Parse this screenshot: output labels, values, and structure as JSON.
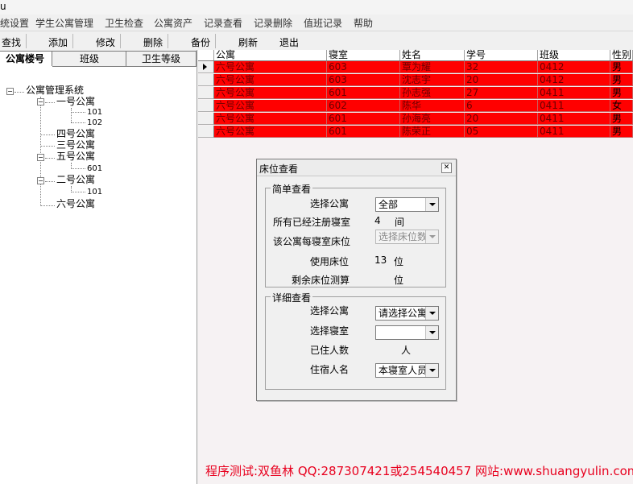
{
  "window": {
    "title_fragment": "u"
  },
  "menu": [
    "统设置",
    "学生公寓管理",
    "卫生检查",
    "公寓资产",
    "记录查看",
    "记录删除",
    "值班记录",
    "帮助"
  ],
  "toolbar": {
    "find": "查找",
    "add": "添加",
    "edit": "修改",
    "delete": "删除",
    "backup": "备份",
    "refresh": "刷新",
    "exit": "退出"
  },
  "tabs": [
    "公寓楼号",
    "班级",
    "卫生等级"
  ],
  "tree": {
    "root": "公寓管理系统",
    "b1": "一号公寓",
    "b1_r1": "101",
    "b1_r2": "102",
    "b4": "四号公寓",
    "b3": "三号公寓",
    "b5": "五号公寓",
    "b5_r1": "601",
    "b2": "二号公寓",
    "b2_r1": "101",
    "b6": "六号公寓"
  },
  "grid": {
    "columns": [
      "公寓",
      "寝室",
      "姓名",
      "学号",
      "班级",
      "性别"
    ],
    "rows": [
      [
        "六号公寓",
        "603",
        "覃为耀",
        "32",
        "0412",
        "男"
      ],
      [
        "六号公寓",
        "603",
        "沈志宇",
        "20",
        "0412",
        "男"
      ],
      [
        "六号公寓",
        "601",
        "孙志强",
        "27",
        "0411",
        "男"
      ],
      [
        "六号公寓",
        "602",
        "陈华",
        "6",
        "0411",
        "女"
      ],
      [
        "六号公寓",
        "601",
        "孙海亮",
        "20",
        "0411",
        "男"
      ],
      [
        "六号公寓",
        "601",
        "陈荣正",
        "05",
        "0411",
        "男"
      ]
    ]
  },
  "dialog": {
    "title": "床位查看",
    "simple": {
      "title": "简单查看",
      "select_building_label": "选择公寓",
      "select_building_value": "全部",
      "registered_label": "所有已经注册寝室",
      "registered_value": "4",
      "registered_unit": "间",
      "beds_per_room_label": "该公寓每寝室床位",
      "beds_per_room_value": "选择床位数",
      "used_label": "使用床位",
      "used_value": "13",
      "used_unit": "位",
      "remaining_label": "剩余床位测算",
      "remaining_unit": "位"
    },
    "detail": {
      "title": "详细查看",
      "select_building_label": "选择公寓",
      "select_building_value": "请选择公寓",
      "select_room_label": "选择寝室",
      "select_room_value": "",
      "occupied_label": "已住人数",
      "occupied_unit": "人",
      "residents_label": "住宿人名",
      "residents_value": "本寝室人员"
    }
  },
  "footer": "程序测试:双鱼林 QQ:287307421或254540457 网站:www.shuangyulin.com",
  "colors": {
    "row_highlight": "#ff0000",
    "footer_text": "#e8001e"
  }
}
